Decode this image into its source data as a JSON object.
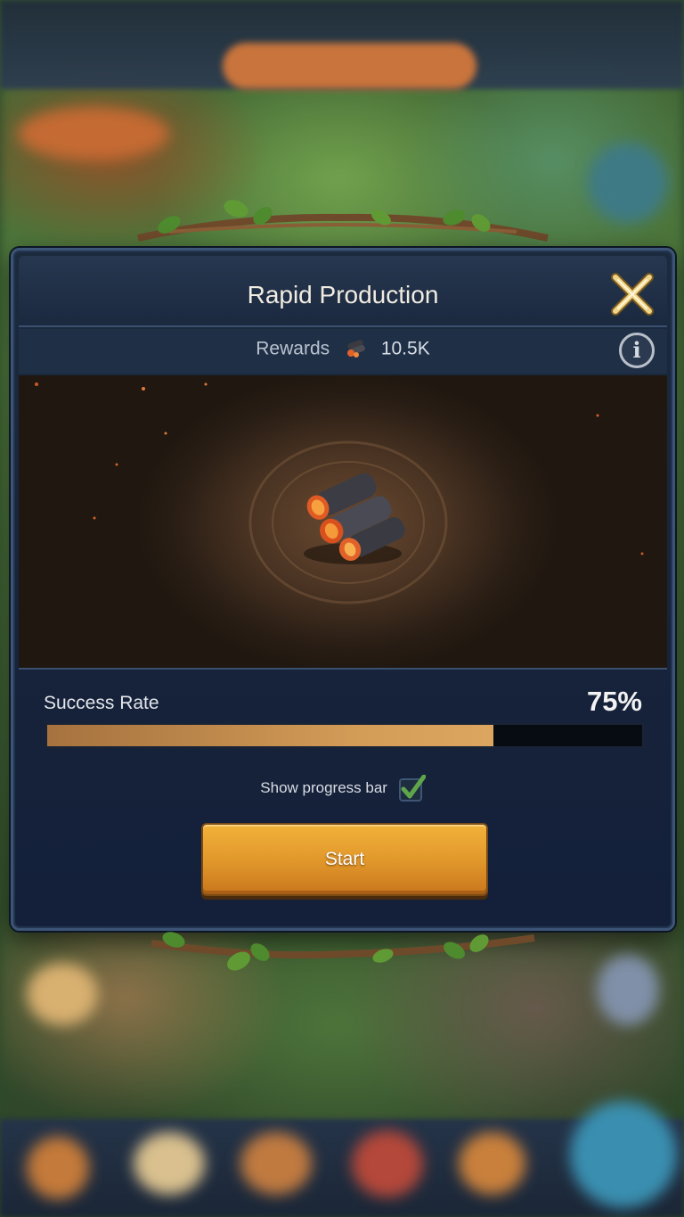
{
  "dialog": {
    "title": "Rapid Production",
    "rewards_label": "Rewards",
    "rewards_icon": "coal-icon",
    "rewards_value": "10.5K",
    "info_icon": "info-icon",
    "info_glyph": "i",
    "close_icon": "close-icon",
    "art_icon": "coal-pile-icon"
  },
  "success_rate": {
    "label": "Success Rate",
    "value_text": "75%",
    "fill_fraction": 0.75
  },
  "progress_toggle": {
    "label": "Show progress bar",
    "checked": true
  },
  "start_button": {
    "label": "Start"
  },
  "colors": {
    "accent_gold": "#e0962a",
    "progress_fill": "#d39c57",
    "check_green": "#5fa64a",
    "panel_bg": "#16233a"
  }
}
